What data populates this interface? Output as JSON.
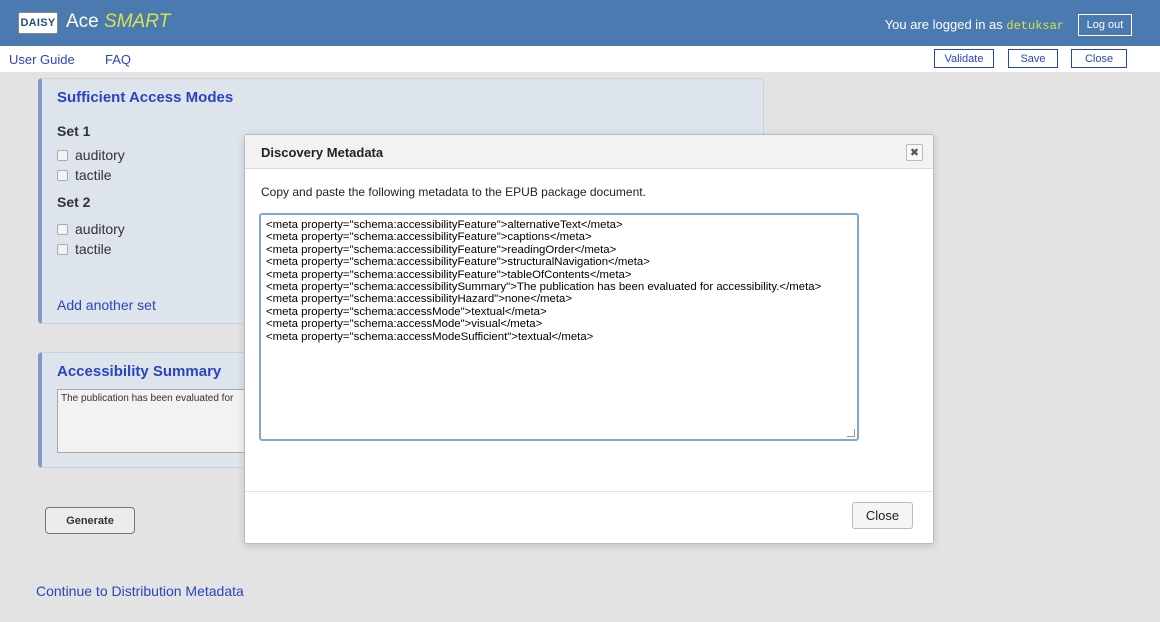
{
  "header": {
    "logo_text": "DAISY",
    "app_name_prefix": "Ace",
    "app_name_suffix": "SMART",
    "login_label": "You are logged in as",
    "username": "detuksar",
    "logout_label": "Log out"
  },
  "nav": {
    "user_guide": "User Guide",
    "faq": "FAQ",
    "validate": "Validate",
    "save": "Save",
    "close": "Close"
  },
  "access_modes": {
    "title": "Sufficient Access Modes",
    "sets": [
      {
        "title": "Set 1",
        "options": [
          "auditory",
          "tactile"
        ]
      },
      {
        "title": "Set 2",
        "options": [
          "auditory",
          "tactile"
        ]
      }
    ],
    "add_set": "Add another set"
  },
  "summary": {
    "title": "Accessibility Summary",
    "text": "The publication has been evaluated for"
  },
  "generate_label": "Generate",
  "continue_label": "Continue to Distribution Metadata",
  "modal": {
    "title": "Discovery Metadata",
    "close_x": "✖",
    "instruction": "Copy and paste the following metadata to the EPUB package document.",
    "lines": [
      "<meta property=\"schema:accessibilityFeature\">alternativeText</meta>",
      "<meta property=\"schema:accessibilityFeature\">captions</meta>",
      "<meta property=\"schema:accessibilityFeature\">readingOrder</meta>",
      "<meta property=\"schema:accessibilityFeature\">structuralNavigation</meta>",
      "<meta property=\"schema:accessibilityFeature\">tableOfContents</meta>",
      "<meta property=\"schema:accessibilitySummary\">The publication has been evaluated for accessibility.</meta>",
      "<meta property=\"schema:accessibilityHazard\">none</meta>",
      "<meta property=\"schema:accessMode\">textual</meta>",
      "<meta property=\"schema:accessMode\">visual</meta>",
      "<meta property=\"schema:accessModeSufficient\">textual</meta>"
    ],
    "close_label": "Close"
  }
}
